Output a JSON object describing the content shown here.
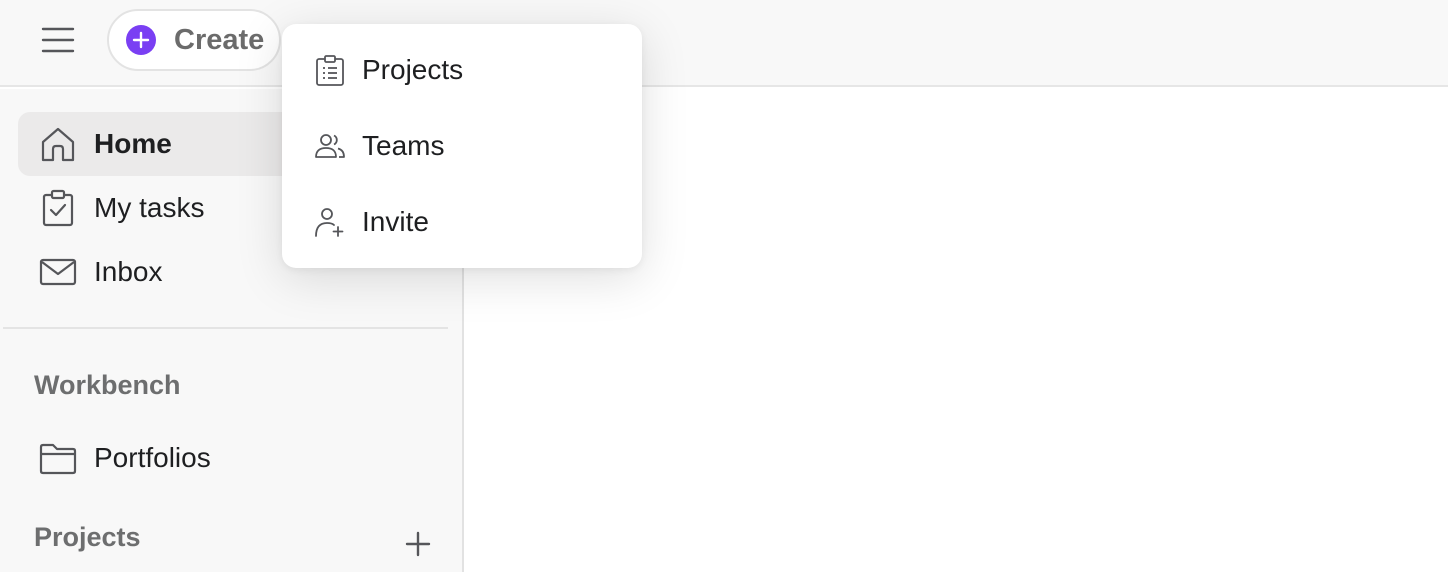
{
  "topbar": {
    "menu_icon": "hamburger-icon",
    "create_label": "Create",
    "create_icon": "plus-circle-icon",
    "accent_color": "#7a3ff3"
  },
  "sidebar": {
    "items": [
      {
        "label": "Home",
        "icon": "home-icon",
        "active": true
      },
      {
        "label": "My tasks",
        "icon": "clipboard-check-icon"
      },
      {
        "label": "Inbox",
        "icon": "envelope-icon"
      }
    ],
    "workbench_title": "Workbench",
    "workbench_items": [
      {
        "label": "Portfolios",
        "icon": "folder-icon"
      }
    ],
    "projects_title": "Projects",
    "add_project_icon": "plus-icon"
  },
  "create_menu": {
    "items": [
      {
        "label": "Projects",
        "icon": "clipboard-list-icon"
      },
      {
        "label": "Teams",
        "icon": "people-icon"
      },
      {
        "label": "Invite",
        "icon": "person-add-icon"
      }
    ]
  }
}
